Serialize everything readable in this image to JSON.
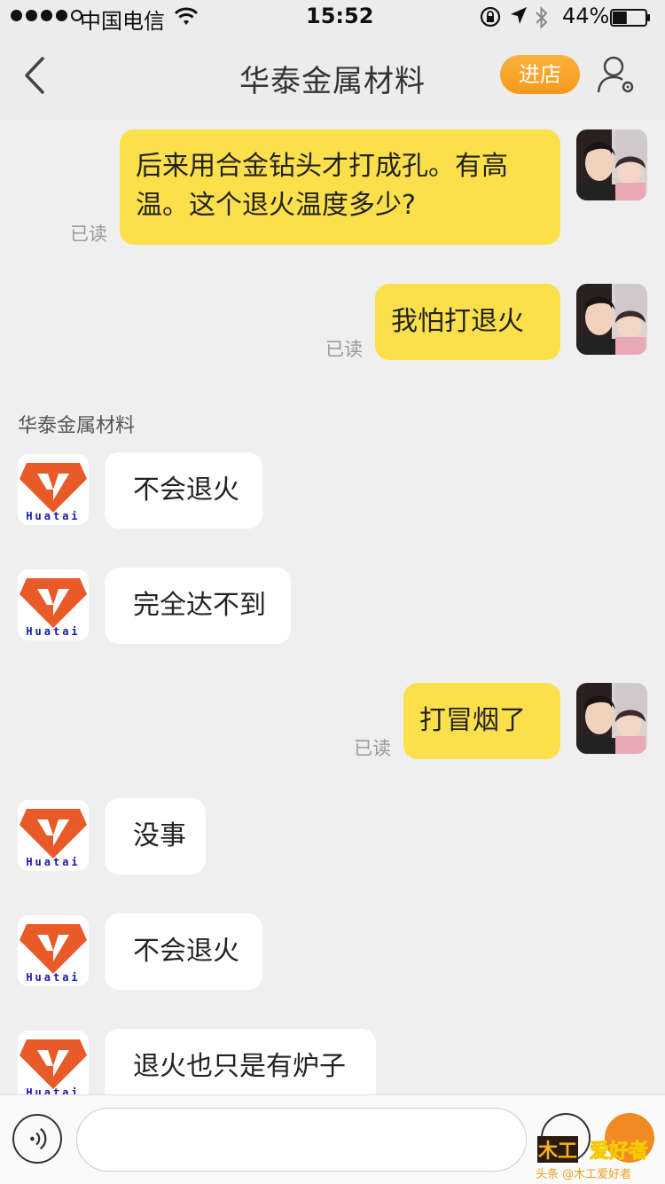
{
  "status_bar": {
    "carrier": "中国电信",
    "time": "15:52",
    "battery_percent_label": "44%",
    "battery_level": 0.44
  },
  "nav": {
    "title": "华泰金属材料",
    "shop_button": "进店"
  },
  "chat": {
    "read_label": "已读",
    "shop_name": "华泰金属材料",
    "shop_logo_text": "Huatai",
    "messages": [
      {
        "from": "me",
        "lines": [
          "后来用合金钻头才打成孔。有高",
          "温。这个退火温度多少?"
        ]
      },
      {
        "from": "me",
        "lines": [
          "我怕打退火"
        ]
      },
      {
        "from": "shop",
        "lines": [
          "不会退火"
        ]
      },
      {
        "from": "shop",
        "lines": [
          "完全达不到"
        ]
      },
      {
        "from": "me",
        "lines": [
          "打冒烟了"
        ]
      },
      {
        "from": "shop",
        "lines": [
          "没事"
        ]
      },
      {
        "from": "shop",
        "lines": [
          "不会退火"
        ]
      },
      {
        "from": "shop",
        "lines": [
          "退火也只是有炉子"
        ]
      }
    ]
  },
  "input": {
    "value": "",
    "placeholder": ""
  },
  "watermark": {
    "logo_text": "木工爱好者",
    "caption": "头条 @木工爱好者"
  },
  "colors": {
    "mine_bubble": "#fbe04b",
    "theirs_bubble": "#ffffff",
    "accent_orange": "#f59a1c",
    "shop_logo": "#e85a28"
  }
}
